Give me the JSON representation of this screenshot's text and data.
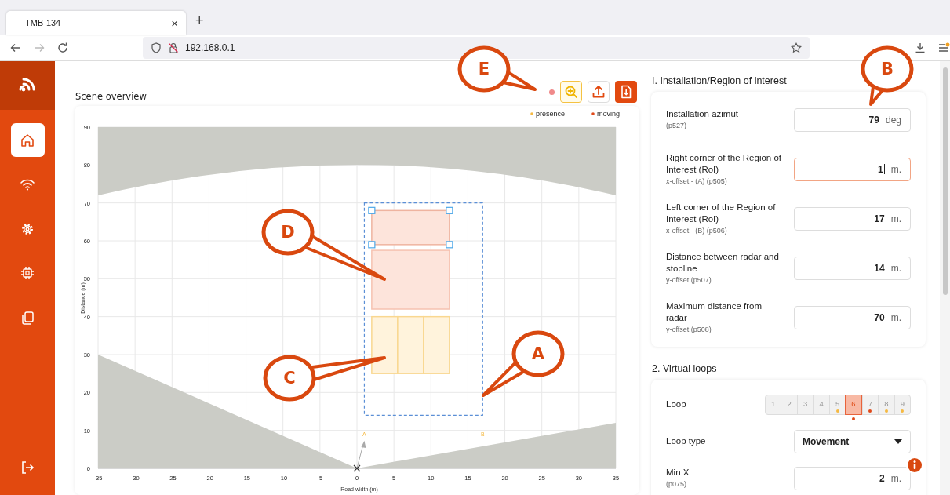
{
  "browser": {
    "tab": {
      "title": "TMB-134",
      "close": "×"
    },
    "new_tab": "+",
    "address": "192.168.0.1"
  },
  "sidebar": {
    "items": [
      {
        "selected": true
      },
      {
        "selected": false
      },
      {
        "selected": false
      },
      {
        "selected": false
      },
      {
        "selected": false
      }
    ]
  },
  "scene": {
    "title": "Scene overview",
    "toolbar": [
      {
        "kind": "accent"
      },
      {
        "kind": "outline"
      },
      {
        "kind": "filled"
      }
    ],
    "legend": [
      {
        "label": "presence",
        "color": "#f5b942"
      },
      {
        "label": "moving",
        "color": "#e04a1a"
      }
    ],
    "x_axis": {
      "title": "Road width (m)",
      "ticks": [
        "-35",
        "-30",
        "-25",
        "-20",
        "-15",
        "-10",
        "-5",
        "0",
        "5",
        "10",
        "15",
        "20",
        "25",
        "30",
        "35"
      ]
    },
    "y_axis": {
      "title": "Distance (m)",
      "ticks": [
        "90",
        "80",
        "70",
        "60",
        "50",
        "40",
        "30",
        "20",
        "10",
        "0"
      ]
    },
    "roi_corners": [
      "A",
      "B"
    ]
  },
  "sections": [
    {
      "title": "I. Installation/Region of interest",
      "rows": [
        {
          "kind": "number",
          "label": "Installation azimut",
          "hint": "(p527)",
          "value": "79",
          "unit": "deg",
          "focused": false
        },
        {
          "kind": "number",
          "label": "Right corner of the Region of Interest (RoI)",
          "hint": "x-offset - (A) (p505)",
          "value": "1",
          "unit": "m.",
          "focused": true
        },
        {
          "kind": "number",
          "label": "Left corner of the Region of Interest (RoI)",
          "hint": "x-offset - (B) (p506)",
          "value": "17",
          "unit": "m.",
          "focused": false
        },
        {
          "kind": "number",
          "label": "Distance between radar and stopline",
          "hint": "y-offset (p507)",
          "value": "14",
          "unit": "m.",
          "focused": false
        },
        {
          "kind": "number",
          "label": "Maximum distance from radar",
          "hint": "y-offset (p508)",
          "value": "70",
          "unit": "m.",
          "focused": false
        }
      ]
    },
    {
      "title": "2. Virtual loops",
      "rows": [
        {
          "kind": "loops",
          "label": "Loop",
          "options": [
            {
              "label": "1",
              "selected": false
            },
            {
              "label": "2",
              "selected": false
            },
            {
              "label": "3",
              "selected": false
            },
            {
              "label": "4",
              "selected": false
            },
            {
              "label": "5",
              "selected": false,
              "color": "#f5b942"
            },
            {
              "label": "6",
              "selected": true,
              "color": "#e04a1a"
            },
            {
              "label": "7",
              "selected": false,
              "color": "#e04a1a"
            },
            {
              "label": "8",
              "selected": false,
              "color": "#f5b942"
            },
            {
              "label": "9",
              "selected": false,
              "color": "#f5b942"
            }
          ]
        },
        {
          "kind": "select",
          "label": "Loop type",
          "value": "Movement"
        },
        {
          "kind": "number",
          "label": "Min X",
          "hint": "(p075)",
          "value": "2",
          "unit": "m.",
          "focused": false,
          "info": true
        }
      ]
    }
  ],
  "callouts": [
    {
      "label": "E"
    },
    {
      "label": "B"
    },
    {
      "label": "D"
    },
    {
      "label": "C"
    },
    {
      "label": "A"
    }
  ]
}
